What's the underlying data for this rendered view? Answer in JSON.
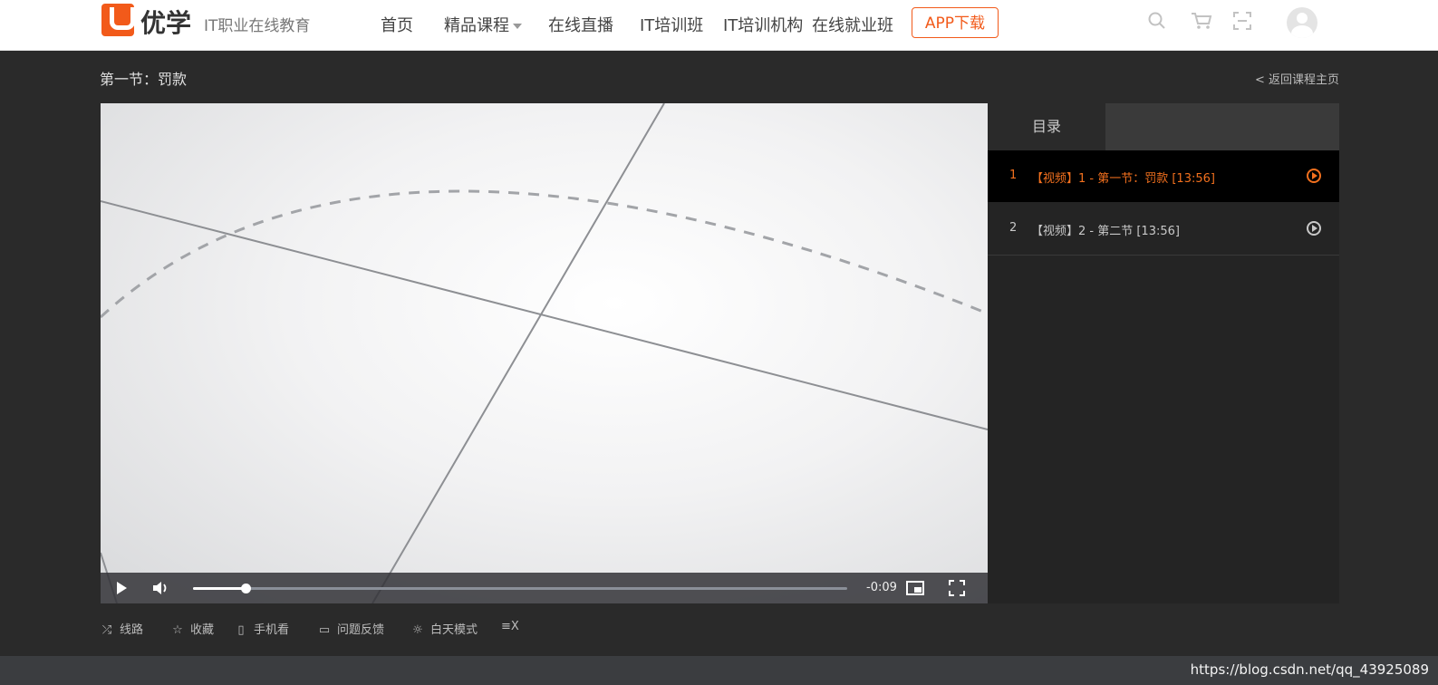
{
  "header": {
    "brand": "优学",
    "tagline": "IT职业在线教育",
    "nav": [
      "首页",
      "精品课程",
      "在线直播",
      "IT培训班",
      "IT培训机构",
      "在线就业班"
    ],
    "app_button": "APP下载"
  },
  "lesson": {
    "title": "第一节：罚款",
    "back_link": "< 返回课程主页"
  },
  "player": {
    "time_remaining": "-0:09",
    "progress": 0.08
  },
  "panel": {
    "tab": "目录",
    "items": [
      {
        "num": "1",
        "title": "【视频】1 - 第一节：罚款 [13:56]",
        "active": true
      },
      {
        "num": "2",
        "title": "【视频】2 - 第二节 [13:56]",
        "active": false
      }
    ]
  },
  "toolbar": {
    "route": "线路",
    "favorite": "收藏",
    "mobile": "手机看",
    "feedback": "问题反馈",
    "day_mode": "白天模式",
    "extra": "≡X"
  },
  "footer": {
    "watermark": "https://blog.csdn.net/qq_43925089"
  },
  "colors": {
    "accent": "#f25a1a",
    "active_item": "#f2701e",
    "background": "#2a2a2a"
  }
}
